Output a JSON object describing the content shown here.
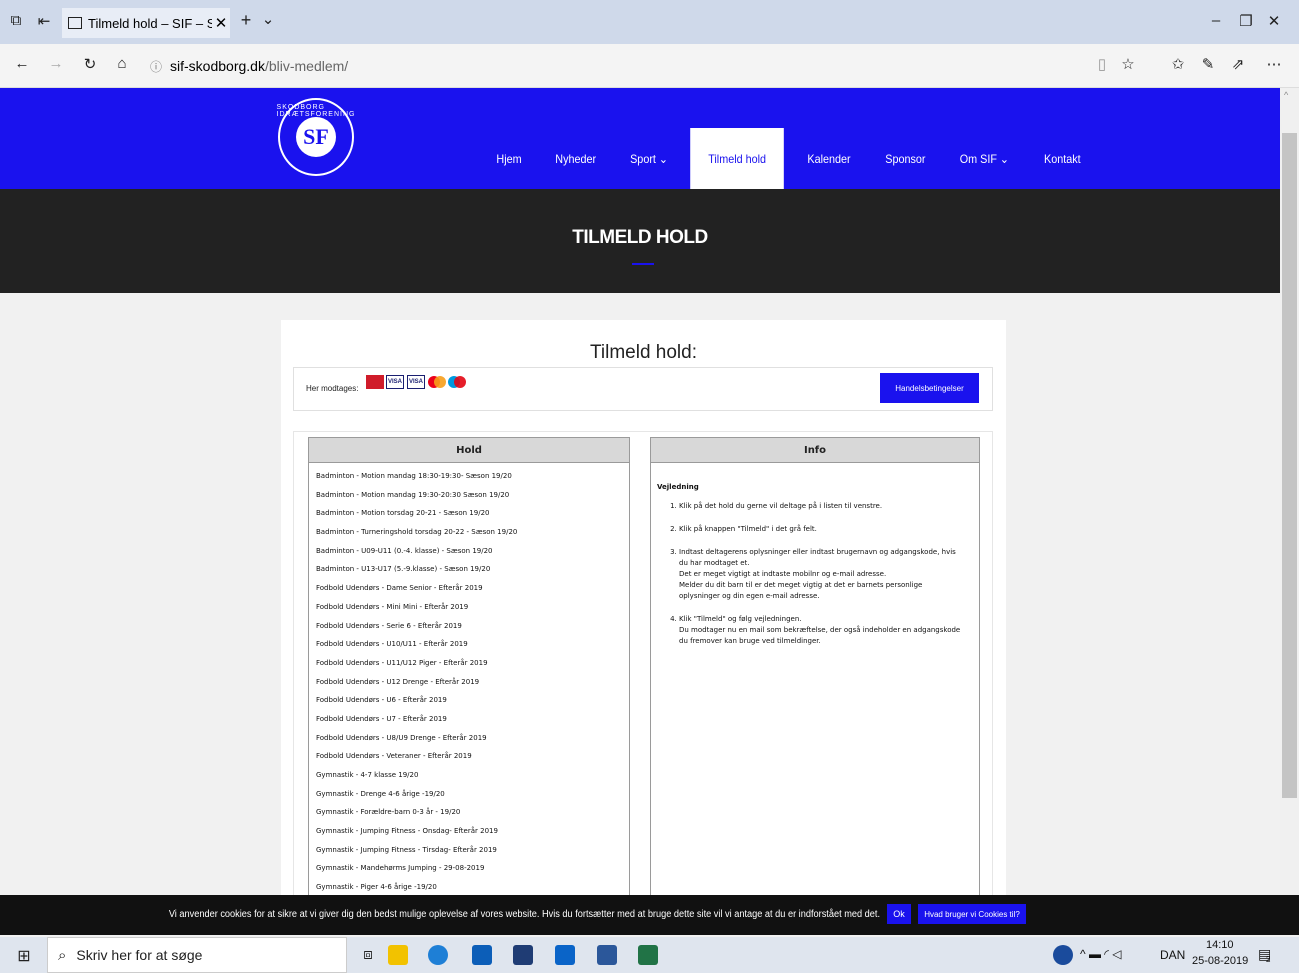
{
  "browser": {
    "tab_title": "Tilmeld hold – SIF – Sko",
    "url_host": "sif-skodborg.dk",
    "url_path": "/bliv-medlem/"
  },
  "site": {
    "logo_text": "SF",
    "logo_ring": "SKODBORG IDRÆTSFORENING",
    "nav": [
      "Hjem",
      "Nyheder",
      "Sport ⌄",
      "Tilmeld hold",
      "Kalender",
      "Sponsor",
      "Om SIF ⌄",
      "Kontakt"
    ],
    "hero_title": "TILMELD HOLD"
  },
  "form": {
    "heading": "Tilmeld hold:",
    "payment_label": "Her modtages:",
    "terms_button": "Handelsbetingelser",
    "hold_header": "Hold",
    "info_header": "Info",
    "hold_items": [
      "Badminton - Motion mandag 18:30-19:30- Sæson 19/20",
      "Badminton - Motion mandag 19:30-20:30 Sæson 19/20",
      "Badminton - Motion torsdag 20-21 - Sæson 19/20",
      "Badminton - Turneringshold torsdag 20-22 - Sæson 19/20",
      "Badminton - U09-U11 (0.-4. klasse) - Sæson 19/20",
      "Badminton - U13-U17 (5.-9.klasse) - Sæson 19/20",
      "Fodbold Udendørs - Dame Senior - Efterår 2019",
      "Fodbold Udendørs - Mini Mini - Efterår 2019",
      "Fodbold Udendørs - Serie 6 - Efterår 2019",
      "Fodbold Udendørs - U10/U11 - Efterår 2019",
      "Fodbold Udendørs - U11/U12 Piger - Efterår 2019",
      "Fodbold Udendørs - U12 Drenge - Efterår 2019",
      "Fodbold Udendørs - U6 - Efterår 2019",
      "Fodbold Udendørs - U7 - Efterår 2019",
      "Fodbold Udendørs - U8/U9 Drenge - Efterår 2019",
      "Fodbold Udendørs - Veteraner - Efterår 2019",
      "Gymnastik - 4-7 klasse 19/20",
      "Gymnastik - Drenge 4-6 årige -19/20",
      "Gymnastik - Forældre-barn 0-3 år - 19/20",
      "Gymnastik - Jumping Fitness - Onsdag- Efterår 2019",
      "Gymnastik - Jumping Fitness - Tirsdag- Efterår 2019",
      "Gymnastik - Mandehørms Jumping - 29-08-2019",
      "Gymnastik - Piger 4-6 årige -19/20"
    ],
    "info": {
      "heading": "Vejledning",
      "steps": [
        [
          "Klik på det hold du gerne vil deltage på i listen til venstre."
        ],
        [
          "Klik på knappen \"Tilmeld\" i det grå felt."
        ],
        [
          "Indtast deltagerens oplysninger eller indtast brugernavn og adgangskode, hvis du har modtaget et.",
          "Det er meget vigtigt at indtaste mobilnr og e-mail adresse.",
          "Melder du dit barn til er det meget vigtig at det er barnets personlige oplysninger og din egen e-mail adresse."
        ],
        [
          "Klik \"Tilmeld\" og følg vejledningen.",
          "Du modtager nu en mail som bekræftelse, der også indeholder en adgangskode du fremover kan bruge ved tilmeldinger."
        ]
      ]
    }
  },
  "cookie": {
    "text": "Vi anvender cookies for at sikre at vi giver dig den bedst mulige oplevelse af vores website. Hvis du fortsætter med at bruge dette site vil vi antage at du er indforstået med det.",
    "ok": "Ok",
    "more": "Hvad bruger vi Cookies til?"
  },
  "taskbar": {
    "search_placeholder": "Skriv her for at søge",
    "lang": "DAN",
    "time": "14:10",
    "date": "25-08-2019",
    "notifications": "2"
  },
  "colors": {
    "brand_blue": "#1a12ee",
    "hero_dark": "#222222"
  }
}
